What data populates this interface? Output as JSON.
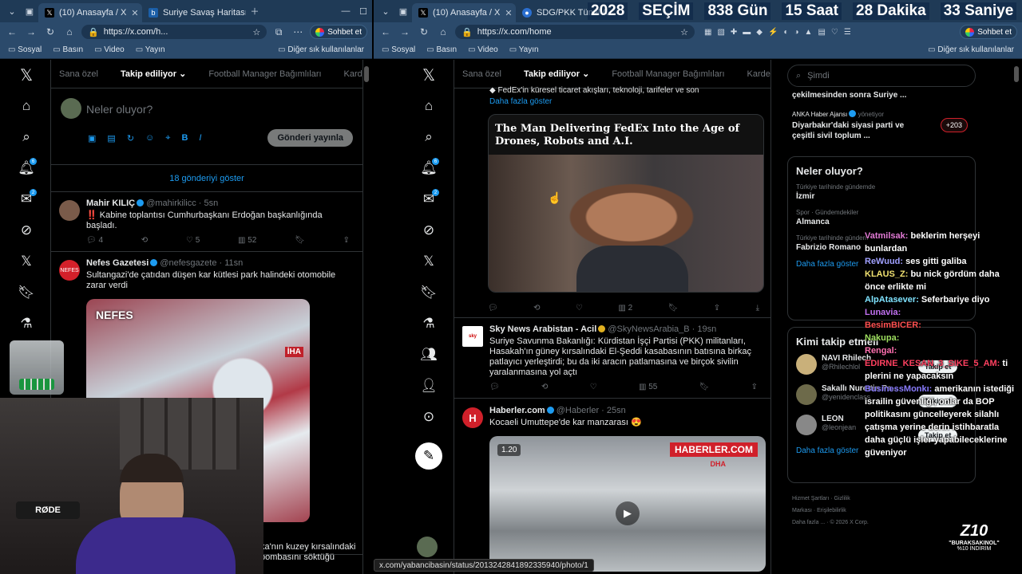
{
  "countdown": {
    "year": "2028",
    "label": "SEÇİM",
    "days": "838 Gün",
    "hours": "15 Saat",
    "minutes": "28 Dakika",
    "seconds": "33 Saniye"
  },
  "left_window": {
    "tabs": [
      {
        "label": "(10) Anasayfa / X"
      },
      {
        "label": "Suriye Savaş Haritası - Son"
      }
    ],
    "url": "https://x.com/h...",
    "profile_button": "Sohbet et",
    "bookmarks": [
      "Sosyal",
      "Basın",
      "Video",
      "Yayın"
    ],
    "bookmarks_other": "Diğer sık kullanılanlar",
    "feed_tabs": [
      "Sana özel",
      "Takip ediliyor",
      "Football Manager Bağımlıları",
      "Kardeşler Kır"
    ],
    "composer": {
      "placeholder": "Neler oluyor?",
      "post_button": "Gönderi yayınla"
    },
    "show_posts": "18 gönderiyi göster",
    "tweets": [
      {
        "name": "Mahir KILIÇ",
        "handle": "@mahirkilicc",
        "time": "5sn",
        "text": "‼️ Kabine toplantısı Cumhurbaşkanı Erdoğan başkanlığında başladı.",
        "replies": "4",
        "likes": "5",
        "views": "52"
      },
      {
        "name": "Nefes Gazetesi",
        "handle": "@nefesgazete",
        "time": "11sn",
        "text": "Sultangazi'de çatıdan düşen kar kütlesi park halindeki otomobile zarar verdi",
        "image_logo": "NEFES",
        "image_tag": "İHA"
      }
    ],
    "partial_text": [
      "ka'nın kuzey kırsalındaki",
      "bombasını söktüğü"
    ]
  },
  "right_window": {
    "tabs": [
      {
        "label": "(10) Anasayfa / X"
      },
      {
        "label": "SDG/PKK Tünel Ağı"
      }
    ],
    "url": "https://x.com/home",
    "profile_button": "Sohbet et",
    "bookmarks": [
      "Sosyal",
      "Basın",
      "Video",
      "Yayın"
    ],
    "bookmarks_other": "Diğer sık kullanılanlar",
    "feed_tabs": [
      "Sana özel",
      "Takip ediliyor",
      "Football Manager Bağımlıları",
      "Kardeşler Kıra"
    ],
    "top_snippet": "FedEx'in küresel ticaret akışları, teknoloji, tarifeler ve son",
    "more_link": "Daha fazla göster",
    "article": {
      "title": "The Man Delivering FedEx Into the Age of Drones, Robots and A.I.",
      "views": "2"
    },
    "tweets": [
      {
        "name": "Sky News Arabistan - Acil",
        "handle": "@SkyNewsArabia_B",
        "time": "19sn",
        "text": "Suriye Savunma Bakanlığı: Kürdistan İşçi Partisi (PKK) militanları, Hasakah'ın güney kırsalındaki El-Şeddi kasabasının batısına birkaç patlayıcı yerleştirdi; bu da iki aracın patlamasına ve birçok sivilin yaralanmasına yol açtı",
        "views": "55"
      },
      {
        "name": "Haberler.com",
        "handle": "@Haberler",
        "time": "25sn",
        "text": "Kocaeli Umuttepe'de kar manzarası 😍",
        "video_time": "1.20",
        "video_logo": "HABERLER.COM",
        "video_sub": "DHA"
      }
    ],
    "search_placeholder": "Şimdi",
    "top_items": [
      {
        "text": "çekilmesinden sonra Suriye ..."
      },
      {
        "source": "ANKA Haber Ajansı",
        "role": "yönetiyor",
        "text": "Diyarbakır'daki siyasi parti ve çeşitli sivil toplum ...",
        "count": "+203"
      }
    ],
    "trends_title": "Neler oluyor?",
    "trends": [
      {
        "sub": "Türkiye tarihinde gündemde",
        "name": "İzmir"
      },
      {
        "sub": "Spor · Gündemdekiler",
        "name": "Almanca"
      },
      {
        "sub": "Türkiye tarihinde gündem",
        "name": "Fabrizio Romano"
      }
    ],
    "trends_more": "Daha fazla göster",
    "follow_title": "Kimi takip etmeli",
    "follow": [
      {
        "name": "NAVI Rhilech",
        "handle": "@Rhilechlol",
        "button": "Takip et"
      },
      {
        "name": "Sakallı Nurettin Pa...",
        "handle": "@yenidenclass",
        "button": "Takip et"
      },
      {
        "name": "LEON",
        "handle": "@leonjean",
        "button": "Takip et"
      }
    ],
    "follow_more": "Daha fazla göster",
    "footer": [
      "Hizmet Şartları",
      "Gizlilik",
      "Markası",
      "Erişilebilirlik",
      "Daha fazla ...",
      "© 2026 X Corp."
    ],
    "status_url": "x.com/yabancibasin/status/2013242841892335940/photo/1"
  },
  "chat": [
    {
      "user": "Vatmilsak:",
      "msg": "beklerim herşeyi bunlardan",
      "color": "#e47bd7"
    },
    {
      "user": "ReWuud:",
      "msg": "ses gitti galiba",
      "color": "#a0a0ff"
    },
    {
      "user": "KLAUS_Z:",
      "msg": "bu nick gördüm daha önce erlikte mi",
      "color": "#f0e070"
    },
    {
      "user": "AlpAtasever:",
      "msg": "Seferbariye diyo",
      "color": "#7fe3ff"
    },
    {
      "user": "Lunavia:",
      "msg": "",
      "color": "#c070f0"
    },
    {
      "user": "BesimBICER:",
      "msg": "",
      "color": "#ff5050"
    },
    {
      "user": "Nakupa:",
      "msg": "",
      "color": "#9fe060"
    },
    {
      "user": "Rengal:",
      "msg": "",
      "color": "#ff70b0"
    },
    {
      "user": "EDIRNE_KESAN_3_SIKE_5_AM:",
      "msg": "ti plerini ne yapacaksın",
      "color": "#ff4060"
    },
    {
      "user": "BusinessMonkı:",
      "msg": "amerikanın istediği israilin güvenliği, onlar da BOP politikasını güncelleyerek silahlı çatışma yerine derin istihbaratla daha güçlü işler yapabileceklerine güveniyor",
      "color": "#8a7cff"
    }
  ],
  "overlay": {
    "logo": "Z10",
    "sponsor": "\"BURAKSAKINOL\"",
    "discount": "%10 İNDİRİM",
    "mic_brand": "RØDE"
  }
}
